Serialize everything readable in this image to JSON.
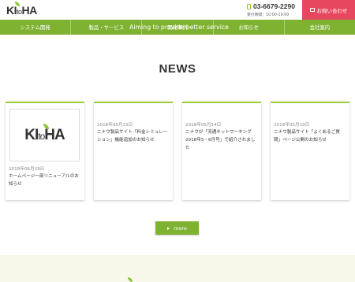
{
  "header": {
    "logo_prefix": "KI",
    "logo_to": "to",
    "logo_suffix": "HA",
    "phone": "03-6679-2290",
    "hours": "受付時間：10:00-19:00",
    "contact_label": "お問い合わせ"
  },
  "nav": {
    "items": [
      {
        "label": "システム開発"
      },
      {
        "label": "製品・サービス"
      },
      {
        "label": "開発事例"
      },
      {
        "label": "お知らせ"
      },
      {
        "label": "会社案内"
      }
    ],
    "tagline": "Aiming to provide better service"
  },
  "main": {
    "title": "NEWS",
    "cards": [
      {
        "date": "2018年06月29日",
        "title": "ホームページ一部リニューアルのお知らせ"
      },
      {
        "date": "2018年05月15日",
        "title": "ニナウ製品サイト「料金シミュレーション」機能追加のお知らせ"
      },
      {
        "date": "2018年05月14日",
        "title": "ニナウが「流通ネットワーキング 2018年5・6月号」で紹介されました"
      },
      {
        "date": "2018年05月10日",
        "title": "ニナウ製品サイト「よくあるご質問」ページ公開のお知らせ"
      }
    ],
    "more_label": "more"
  },
  "colors": {
    "accent_green": "#80b232",
    "contact_red": "#e8485f"
  },
  "icons": [
    "phone-icon",
    "mail-icon",
    "leaf-icon",
    "arrow-right-icon"
  ]
}
